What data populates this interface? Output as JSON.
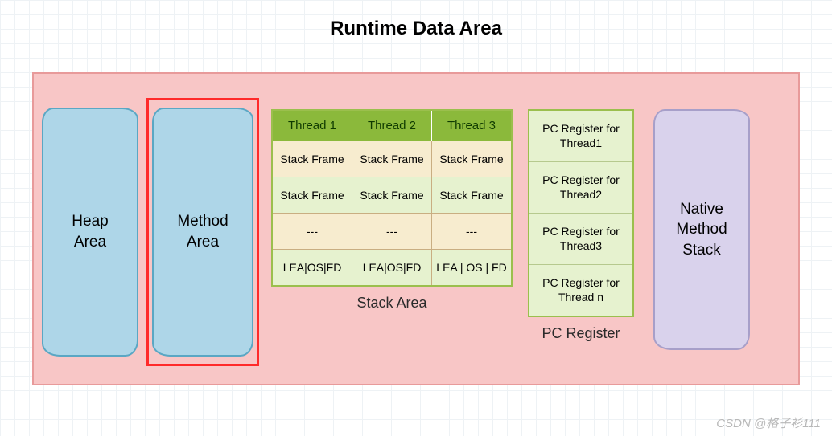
{
  "title": "Runtime Data Area",
  "heap": {
    "line1": "Heap",
    "line2": "Area"
  },
  "method": {
    "line1": "Method",
    "line2": "Area"
  },
  "stack": {
    "label": "Stack Area",
    "headers": [
      "Thread 1",
      "Thread 2",
      "Thread 3"
    ],
    "rows": [
      {
        "cells": [
          "Stack Frame",
          "Stack Frame",
          "Stack Frame"
        ],
        "cls": "bg-cream"
      },
      {
        "cells": [
          "Stack Frame",
          "Stack Frame",
          "Stack Frame"
        ],
        "cls": "bg-green"
      },
      {
        "cells": [
          "---",
          "---",
          "---"
        ],
        "cls": "bg-cream"
      },
      {
        "cells": [
          "LEA|OS|FD",
          "LEA|OS|FD",
          "LEA | OS | FD"
        ],
        "cls": "bg-green"
      }
    ]
  },
  "pc": {
    "label": "PC Register",
    "cells": [
      "PC Register for  Thread1",
      "PC Register for  Thread2",
      "PC Register for  Thread3",
      "PC Register for  Thread n"
    ]
  },
  "native": {
    "line1": "Native",
    "line2": "Method",
    "line3": "Stack"
  },
  "watermark": "CSDN @格子衫111"
}
